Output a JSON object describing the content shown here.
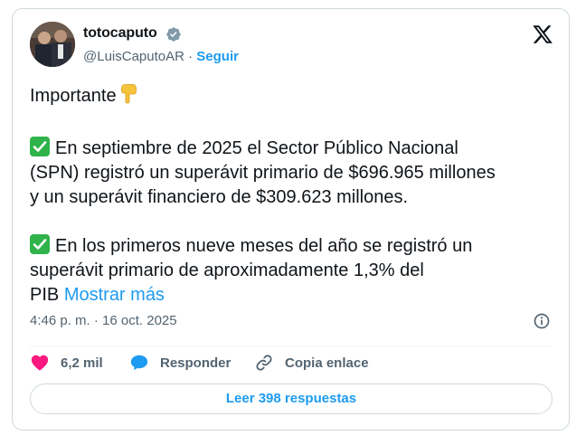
{
  "author": {
    "display_name": "totocaputo",
    "handle": "@LuisCaputoAR",
    "separator": " · ",
    "follow_label": "Seguir",
    "avatar_icon": "profile-photo",
    "verified_icon": "verified-badge-icon"
  },
  "platform_logo": "x-logo-icon",
  "tweet": {
    "line1": "Importante",
    "p2_lines": [
      "En septiembre de 2025 el Sector Público Nacional",
      "(SPN) registró un superávit primario de $696.965 millones",
      "y un superávit financiero de $309.623 millones."
    ],
    "p3_lines": [
      "En los primeros nueve meses del año se registró un",
      "superávit primario de aproximadamente 1,3% del",
      "PIB"
    ],
    "show_more": "Mostrar más"
  },
  "meta": {
    "timestamp": "4:46 p. m. · 16 oct. 2025"
  },
  "actions": {
    "likes": "6,2 mil",
    "reply": "Responder",
    "copy_link": "Copia enlace"
  },
  "read_replies": "Leer 398 respuestas",
  "colors": {
    "accent": "#1d9bf0",
    "like": "#f91880",
    "check": "#2fb34a"
  }
}
